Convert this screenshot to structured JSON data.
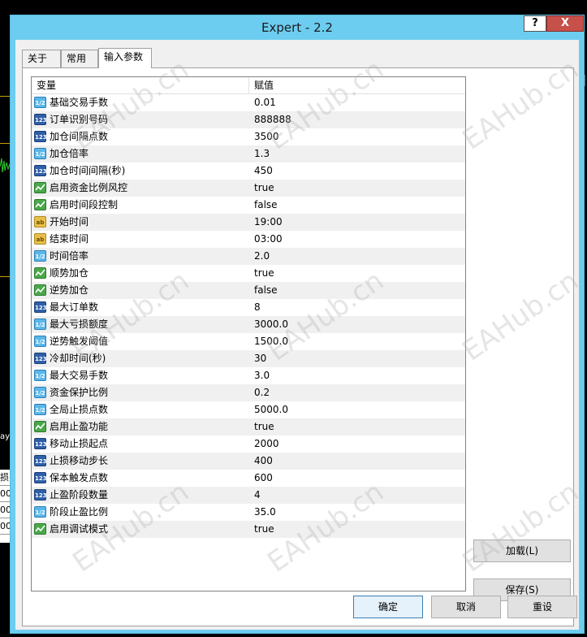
{
  "window": {
    "title": "Expert - 2.2",
    "help_label": "?",
    "close_label": "X"
  },
  "tabs": [
    {
      "label": "关于"
    },
    {
      "label": "常用"
    },
    {
      "label": "输入参数"
    }
  ],
  "grid": {
    "header_variable": "变量",
    "header_value": "赋值",
    "rows": [
      {
        "type": "real",
        "icon": "1/2",
        "name": "基础交易手数",
        "value": "0.01"
      },
      {
        "type": "int",
        "icon": "123",
        "name": "订单识别号码",
        "value": "888888"
      },
      {
        "type": "int",
        "icon": "123",
        "name": "加仓间隔点数",
        "value": "3500"
      },
      {
        "type": "real",
        "icon": "1/2",
        "name": "加仓倍率",
        "value": "1.3"
      },
      {
        "type": "int",
        "icon": "123",
        "name": "加仓时间间隔(秒)",
        "value": "450"
      },
      {
        "type": "bool",
        "icon": "bool",
        "name": "启用资金比例风控",
        "value": "true"
      },
      {
        "type": "bool",
        "icon": "bool",
        "name": "启用时间段控制",
        "value": "false"
      },
      {
        "type": "str",
        "icon": "ab",
        "name": "开始时间",
        "value": "19:00"
      },
      {
        "type": "str",
        "icon": "ab",
        "name": "结束时间",
        "value": "03:00"
      },
      {
        "type": "real",
        "icon": "1/2",
        "name": "时间倍率",
        "value": "2.0"
      },
      {
        "type": "bool",
        "icon": "bool",
        "name": "顺势加仓",
        "value": "true"
      },
      {
        "type": "bool",
        "icon": "bool",
        "name": "逆势加仓",
        "value": "false"
      },
      {
        "type": "int",
        "icon": "123",
        "name": "最大订单数",
        "value": "8"
      },
      {
        "type": "real",
        "icon": "1/2",
        "name": "最大亏损额度",
        "value": "3000.0"
      },
      {
        "type": "real",
        "icon": "1/2",
        "name": "逆势触发阈值",
        "value": "1500.0"
      },
      {
        "type": "int",
        "icon": "123",
        "name": "冷却时间(秒)",
        "value": "30"
      },
      {
        "type": "real",
        "icon": "1/2",
        "name": "最大交易手数",
        "value": "3.0"
      },
      {
        "type": "real",
        "icon": "1/2",
        "name": "资金保护比例",
        "value": "0.2"
      },
      {
        "type": "real",
        "icon": "1/2",
        "name": "全局止损点数",
        "value": "5000.0"
      },
      {
        "type": "bool",
        "icon": "bool",
        "name": "启用止盈功能",
        "value": "true"
      },
      {
        "type": "int",
        "icon": "123",
        "name": "移动止损起点",
        "value": "2000"
      },
      {
        "type": "int",
        "icon": "123",
        "name": "止损移动步长",
        "value": "400"
      },
      {
        "type": "int",
        "icon": "123",
        "name": "保本触发点数",
        "value": "600"
      },
      {
        "type": "int",
        "icon": "123",
        "name": "止盈阶段数量",
        "value": "4"
      },
      {
        "type": "real",
        "icon": "1/2",
        "name": "阶段止盈比例",
        "value": "35.0"
      },
      {
        "type": "bool",
        "icon": "bool",
        "name": "启用调试模式",
        "value": "true"
      }
    ]
  },
  "buttons": {
    "load": "加载(L)",
    "save": "保存(S)",
    "ok": "确定",
    "cancel": "取消",
    "reset": "重设"
  },
  "watermark": "EAHub.cn",
  "background": {
    "left_label": "ay",
    "left_cells": [
      "损",
      "00",
      "00",
      "00"
    ]
  }
}
